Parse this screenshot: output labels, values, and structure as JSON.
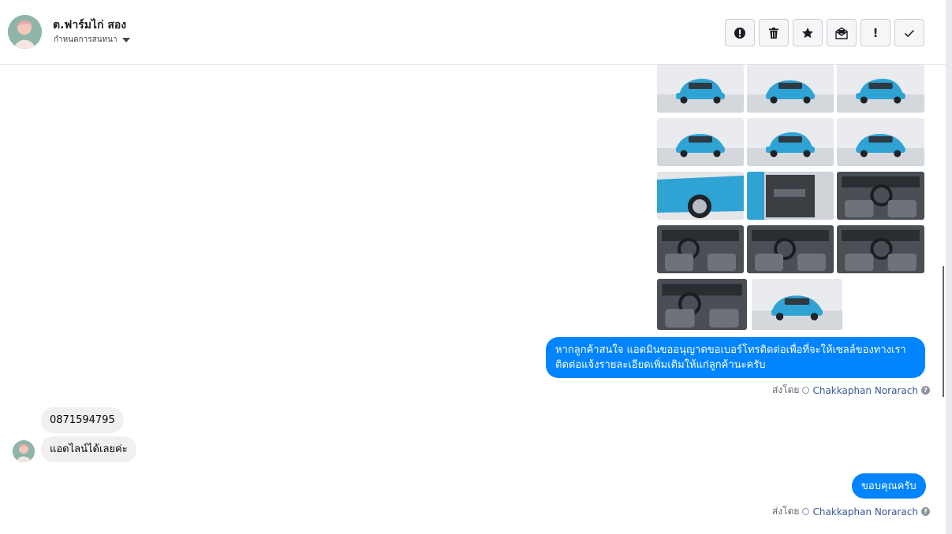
{
  "header": {
    "contact_name": "ต.ฟาร์มไก่ สอง",
    "assign_label": "กำหนดการสนทนา",
    "toolbar": [
      {
        "name": "report-spam-button",
        "icon": "alert-circle-icon"
      },
      {
        "name": "delete-button",
        "icon": "trash-icon"
      },
      {
        "name": "star-button",
        "icon": "star-icon"
      },
      {
        "name": "mark-unread-button",
        "icon": "envelope-icon"
      },
      {
        "name": "follow-up-button",
        "icon": "exclamation-icon",
        "glyph": "!"
      },
      {
        "name": "mark-done-button",
        "icon": "check-icon"
      }
    ]
  },
  "photos": [
    {
      "name": "car-photo-front",
      "kind": "exterior"
    },
    {
      "name": "car-photo-front-angle",
      "kind": "exterior"
    },
    {
      "name": "car-photo-rear-angle",
      "kind": "exterior"
    },
    {
      "name": "car-photo-rear",
      "kind": "exterior"
    },
    {
      "name": "car-photo-rear-side",
      "kind": "exterior"
    },
    {
      "name": "car-photo-side",
      "kind": "exterior"
    },
    {
      "name": "car-photo-wheel",
      "kind": "wheel"
    },
    {
      "name": "car-photo-door",
      "kind": "door"
    },
    {
      "name": "car-photo-dashboard",
      "kind": "interior"
    },
    {
      "name": "car-photo-seats",
      "kind": "interior"
    },
    {
      "name": "car-photo-steering",
      "kind": "interior"
    },
    {
      "name": "car-photo-rear-seats",
      "kind": "interior"
    },
    {
      "name": "car-photo-cabin",
      "kind": "interior"
    },
    {
      "name": "car-photo-trunk",
      "kind": "exterior"
    }
  ],
  "messages": {
    "outgoing_1_line1": "หากลูกค้าสนใจ แอดมินขออนุญาตขอเบอร์โทรติดต่อเพื่อที่จะให้เซลล์ของทางเรา",
    "outgoing_1_line2": "ติดต่อแจ้งรายละเอียดเพิ่มเติมให้แก่ลูกค้านะครับ",
    "incoming_1": "0871594795",
    "incoming_2": "แอดไลน์ได้เลยค่ะ",
    "outgoing_2": "ขอบคุณครับ"
  },
  "sent_by": {
    "label": "ส่งโดย",
    "agent": "Chakkaphan Norarach",
    "help": "?"
  },
  "colors": {
    "accent": "#0084ff",
    "incoming_bubble": "#f1f0f0",
    "agent_link": "#385898",
    "car_blue": "#2ea3d4"
  }
}
